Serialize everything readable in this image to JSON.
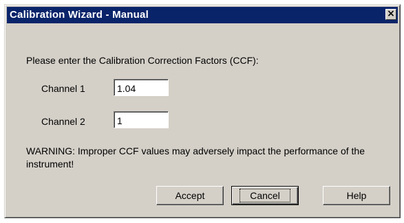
{
  "window": {
    "title": "Calibration Wizard - Manual",
    "close_glyph": "×"
  },
  "prompt": "Please enter the Calibration Correction Factors (CCF):",
  "channels": [
    {
      "label": "Channel 1",
      "value": "1.04"
    },
    {
      "label": "Channel 2",
      "value": "1"
    }
  ],
  "warning": "WARNING:  Improper CCF values may adversely impact the performance of the instrument!",
  "buttons": {
    "accept": "Accept",
    "cancel": "Cancel",
    "help": "Help"
  }
}
